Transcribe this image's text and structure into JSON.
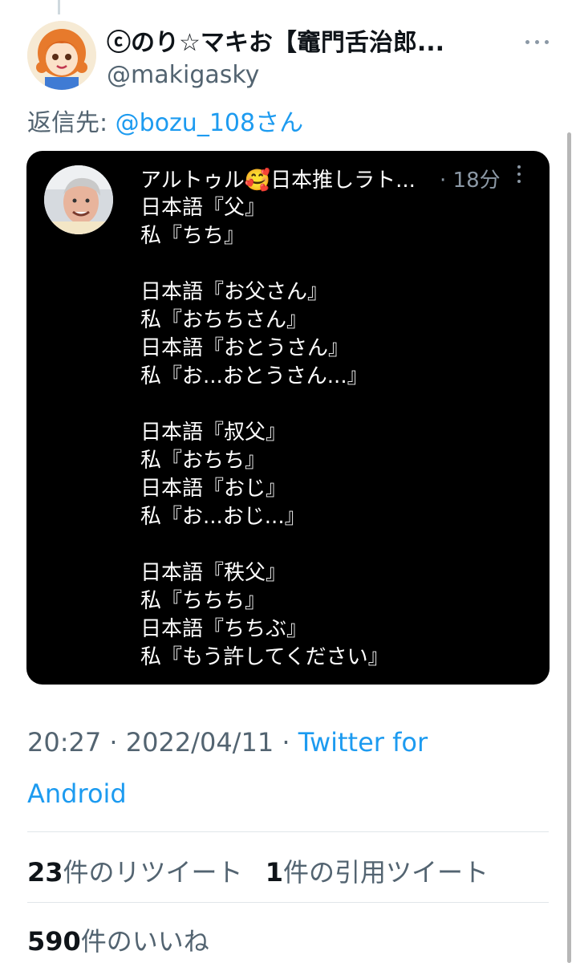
{
  "tweet": {
    "author_name": "ⓒのり☆マキお【竈門舌治郎...",
    "author_handle": "@makigasky",
    "reply_prefix": "返信先: ",
    "reply_to": "@bozu_108さん",
    "timestamp": "20:27 · 2022/04/11 · ",
    "source": "Twitter for Android",
    "retweets_count": "23",
    "retweets_label": "件のリツイート",
    "quotes_count": "1",
    "quotes_label": "件の引用ツイート",
    "likes_count": "590",
    "likes_label": "件のいいね"
  },
  "quoted": {
    "author": "アルトゥル🥰日本推しラト...",
    "time": "· 18分",
    "lines": [
      "日本語『父』",
      "私『ちち』",
      "",
      "日本語『お父さん』",
      "私『おちちさん』",
      "日本語『おとうさん』",
      "私『お...おとうさん...』",
      "",
      "日本語『叔父』",
      "私『おちち』",
      "日本語『おじ』",
      "私『お...おじ...』",
      "",
      "日本語『秩父』",
      "私『ちちち』",
      "日本語『ちちぶ』",
      "私『もう許してください』"
    ]
  },
  "icons": {
    "more": "more-horizontal-icon",
    "quoted_more": "more-vertical-icon"
  },
  "colors": {
    "link": "#1d9bf0",
    "secondary_text": "#536471",
    "primary_text": "#0f1419",
    "card_background": "#000000"
  }
}
